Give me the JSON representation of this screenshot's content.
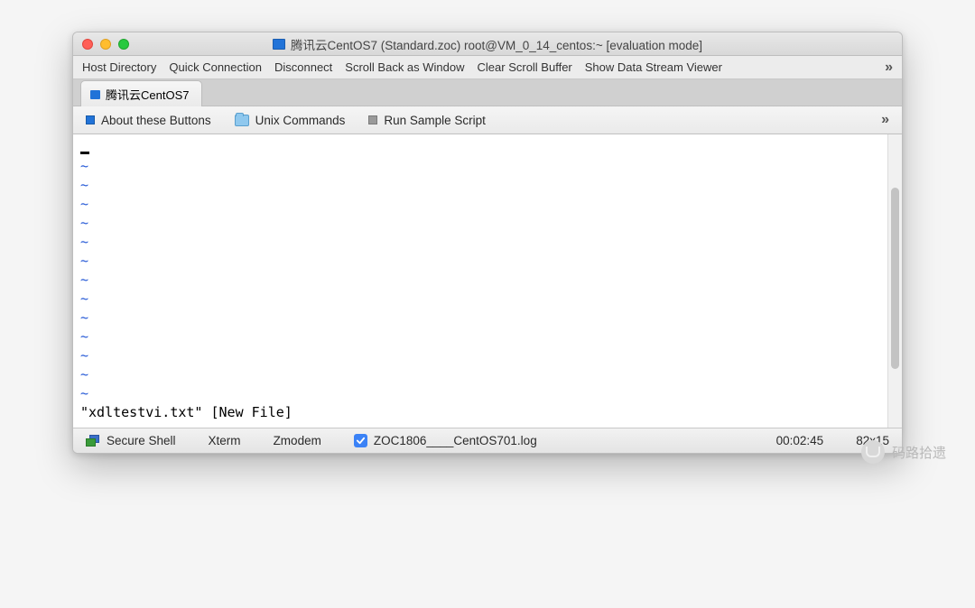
{
  "window": {
    "title": "腾讯云CentOS7 (Standard.zoc) root@VM_0_14_centos:~ [evaluation mode]"
  },
  "menubar": {
    "items": [
      "Host Directory",
      "Quick Connection",
      "Disconnect",
      "Scroll Back as Window",
      "Clear Scroll Buffer",
      "Show Data Stream Viewer"
    ],
    "overflow": "»"
  },
  "tabs": {
    "active_label": "腾讯云CentOS7"
  },
  "quickbar": {
    "about": "About these Buttons",
    "unix": "Unix Commands",
    "sample": "Run Sample Script",
    "overflow": "»"
  },
  "terminal": {
    "tilde": "~",
    "status_line": "\"xdltestvi.txt\" [New File]"
  },
  "statusbar": {
    "protocol": "Secure Shell",
    "term": "Xterm",
    "transfer": "Zmodem",
    "logfile": "ZOC1806____CentOS701.log",
    "elapsed": "00:02:45",
    "geometry": "82x15"
  },
  "watermark": {
    "text": "码路拾遗"
  }
}
